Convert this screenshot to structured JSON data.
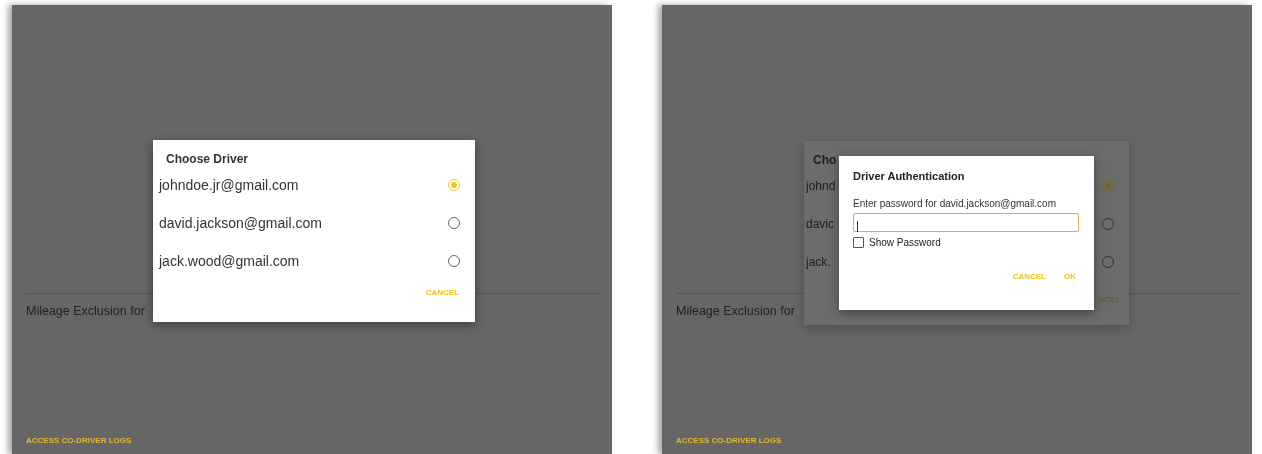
{
  "screens": [
    {
      "mileage_label": "Mileage Exclusion for",
      "access_link": "ACCESS CO-DRIVER LOGS",
      "choose_driver": {
        "title": "Choose Driver",
        "dimmed": false,
        "drivers": [
          {
            "email": "johndoe.jr@gmail.com",
            "selected": true
          },
          {
            "email": "david.jackson@gmail.com",
            "selected": false
          },
          {
            "email": "jack.wood@gmail.com",
            "selected": false
          }
        ],
        "cancel": "CANCEL"
      }
    },
    {
      "mileage_label": "Mileage Exclusion for",
      "access_link": "ACCESS CO-DRIVER LOGS",
      "choose_driver": {
        "title": "Cho",
        "dimmed": true,
        "drivers": [
          {
            "email": "johnd",
            "selected": true
          },
          {
            "email": "davic",
            "selected": false
          },
          {
            "email": "jack.",
            "selected": false
          }
        ],
        "cancel": "NCEL"
      },
      "auth_dialog": {
        "title": "Driver Authentication",
        "prompt": "Enter password for david.jackson@gmail.com",
        "show_password": {
          "label": "Show Password",
          "checked": false
        },
        "buttons": [
          "CANCEL",
          "OK"
        ]
      }
    }
  ]
}
